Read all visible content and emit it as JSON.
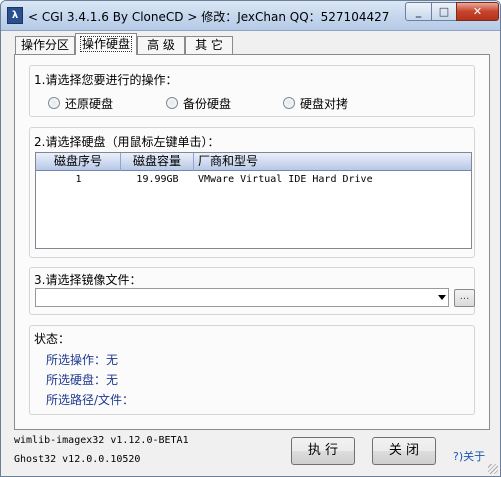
{
  "window": {
    "title": "< CGI 3.4.1.6 By CloneCD > 修改：JexChan  QQ：527104427",
    "icon_text": "λ",
    "minimize": "_",
    "maximize": "□",
    "close": "✕"
  },
  "tabs": [
    {
      "label": "操作分区",
      "active": false
    },
    {
      "label": "操作硬盘",
      "active": true
    },
    {
      "label": "高 级",
      "active": false
    },
    {
      "label": "其 它",
      "active": false
    }
  ],
  "operation": {
    "label": "1.请选择您要进行的操作：",
    "options": [
      {
        "label": "还原硬盘",
        "selected": false
      },
      {
        "label": "备份硬盘",
        "selected": false
      },
      {
        "label": "硬盘对拷",
        "selected": false
      }
    ]
  },
  "disk": {
    "label": "2.请选择硬盘（用鼠标左键单击）：",
    "columns": [
      "磁盘序号",
      "磁盘容量",
      "厂商和型号"
    ],
    "rows": [
      {
        "index": "1",
        "size": "19.99GB",
        "model": "VMware Virtual IDE Hard Drive"
      }
    ]
  },
  "image": {
    "label": "3.请选择镜像文件：",
    "value": "",
    "browse_label": "..."
  },
  "status": {
    "label": "状态：",
    "operation": "所选操作：无",
    "disk": "所选硬盘：无",
    "path": "所选路径/文件："
  },
  "footer": {
    "wimlib": "wimlib-imagex32 v1.12.0-BETA1",
    "ghost": "Ghost32 v12.0.0.10520",
    "execute_label": "执 行",
    "close_label": "关 闭",
    "about_label": "?)关于"
  }
}
